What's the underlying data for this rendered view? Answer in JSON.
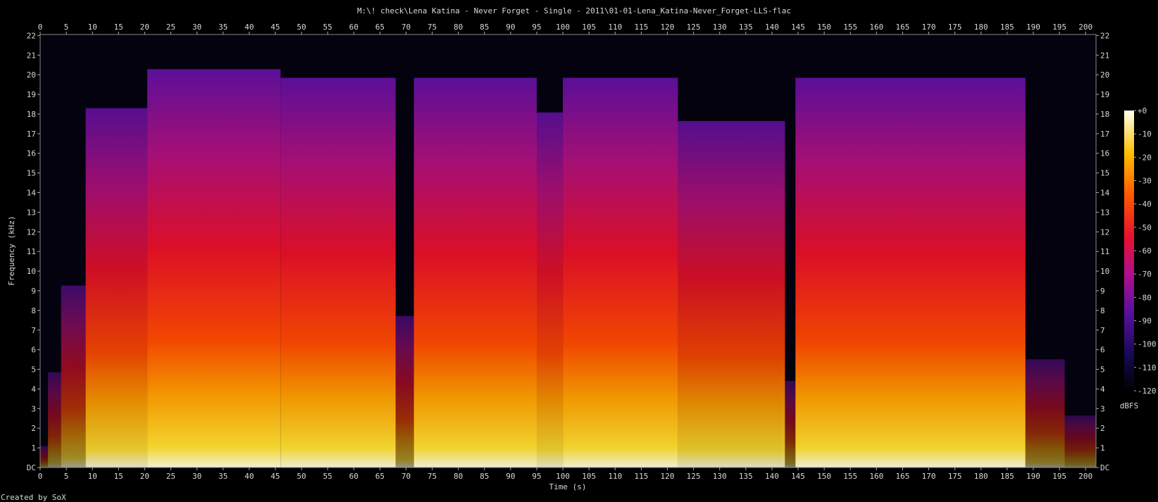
{
  "chart_data": {
    "type": "heatmap",
    "title": "M:\\! check\\Lena Katina - Never Forget - Single - 2011\\01-01-Lena_Katina-Never_Forget-LLS-flac",
    "xlabel": "Time (s)",
    "ylabel": "Frequency (kHz)",
    "xlim": [
      0,
      202
    ],
    "ylim": [
      0,
      22.05
    ],
    "x_ticks": [
      "0",
      "5",
      "10",
      "15",
      "20",
      "25",
      "30",
      "35",
      "40",
      "45",
      "50",
      "55",
      "60",
      "65",
      "70",
      "75",
      "80",
      "85",
      "90",
      "95",
      "100",
      "105",
      "110",
      "115",
      "120",
      "125",
      "130",
      "135",
      "140",
      "145",
      "150",
      "155",
      "160",
      "165",
      "170",
      "175",
      "180",
      "185",
      "190",
      "195",
      "200"
    ],
    "y_ticks": [
      "DC",
      "1",
      "2",
      "3",
      "4",
      "5",
      "6",
      "7",
      "8",
      "9",
      "10",
      "11",
      "12",
      "13",
      "14",
      "15",
      "16",
      "17",
      "18",
      "19",
      "20",
      "21",
      "22"
    ],
    "colorbar": {
      "label": "dBFS",
      "range": [
        -120,
        0
      ],
      "ticks": [
        "+0",
        "-10",
        "-20",
        "-30",
        "-40",
        "-50",
        "-60",
        "-70",
        "-80",
        "-90",
        "-100",
        "-110",
        "-120"
      ]
    },
    "footer": "Created by SoX",
    "segments": [
      {
        "t0": 0,
        "t1": 1.5,
        "level": 0.05
      },
      {
        "t0": 1.5,
        "t1": 4,
        "level": 0.22
      },
      {
        "t0": 4,
        "t1": 8.7,
        "level": 0.42
      },
      {
        "t0": 8.7,
        "t1": 20.5,
        "level": 0.83
      },
      {
        "t0": 20.5,
        "t1": 46,
        "level": 0.92
      },
      {
        "t0": 46,
        "t1": 68,
        "level": 0.9
      },
      {
        "t0": 68,
        "t1": 71.5,
        "level": 0.35
      },
      {
        "t0": 71.5,
        "t1": 95,
        "level": 0.9
      },
      {
        "t0": 95,
        "t1": 100,
        "level": 0.82
      },
      {
        "t0": 100,
        "t1": 122,
        "level": 0.9
      },
      {
        "t0": 122,
        "t1": 142.5,
        "level": 0.8
      },
      {
        "t0": 142.5,
        "t1": 144.5,
        "level": 0.2
      },
      {
        "t0": 144.5,
        "t1": 188.5,
        "level": 0.9
      },
      {
        "t0": 188.5,
        "t1": 196,
        "level": 0.25
      },
      {
        "t0": 196,
        "t1": 202,
        "level": 0.12
      }
    ]
  }
}
